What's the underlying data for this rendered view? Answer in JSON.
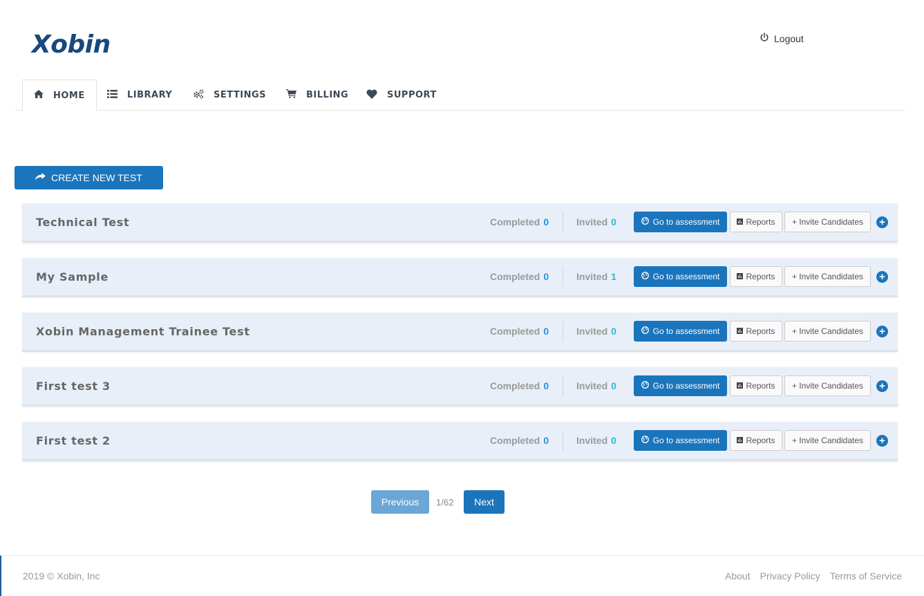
{
  "brand": {
    "logo_text": "Xobin",
    "logo_color": "#17497e"
  },
  "header": {
    "logout_label": "Logout"
  },
  "nav": {
    "tabs": [
      {
        "label": "HOME",
        "icon": "home-icon",
        "active": true
      },
      {
        "label": "LIBRARY",
        "icon": "list-icon",
        "active": false
      },
      {
        "label": "SETTINGS",
        "icon": "gears-icon",
        "active": false
      },
      {
        "label": "BILLING",
        "icon": "cart-icon",
        "active": false
      },
      {
        "label": "SUPPORT",
        "icon": "heart-icon",
        "active": false
      }
    ]
  },
  "actions": {
    "create_label": "CREATE NEW TEST"
  },
  "tests": [
    {
      "name": "Technical Test",
      "completed_label": "Completed",
      "completed": "0",
      "invited_label": "Invited",
      "invited": "0",
      "go_label": "Go to assessment",
      "reports_label": "Reports",
      "invite_label": "+ Invite Candidates",
      "expand_label": "+"
    },
    {
      "name": "My Sample",
      "completed_label": "Completed",
      "completed": "0",
      "invited_label": "Invited",
      "invited": "1",
      "go_label": "Go to assessment",
      "reports_label": "Reports",
      "invite_label": "+ Invite Candidates",
      "expand_label": "+"
    },
    {
      "name": "Xobin Management Trainee Test",
      "completed_label": "Completed",
      "completed": "0",
      "invited_label": "Invited",
      "invited": "0",
      "go_label": "Go to assessment",
      "reports_label": "Reports",
      "invite_label": "+ Invite Candidates",
      "expand_label": "+"
    },
    {
      "name": "First test 3",
      "completed_label": "Completed",
      "completed": "0",
      "invited_label": "Invited",
      "invited": "0",
      "go_label": "Go to assessment",
      "reports_label": "Reports",
      "invite_label": "+ Invite Candidates",
      "expand_label": "+"
    },
    {
      "name": "First test 2",
      "completed_label": "Completed",
      "completed": "0",
      "invited_label": "Invited",
      "invited": "0",
      "go_label": "Go to assessment",
      "reports_label": "Reports",
      "invite_label": "+ Invite Candidates",
      "expand_label": "+"
    }
  ],
  "pagination": {
    "prev_label": "Previous",
    "page_info": "1/62",
    "next_label": "Next"
  },
  "footer": {
    "copyright": "2019 © Xobin, Inc",
    "links": [
      "About",
      "Privacy Policy",
      "Terms of Service"
    ]
  },
  "colors": {
    "primary": "#1b75bc",
    "completed_count": "#2a91e0",
    "invited_count": "#2bb8d2",
    "row_bg": "#e9eff8"
  }
}
